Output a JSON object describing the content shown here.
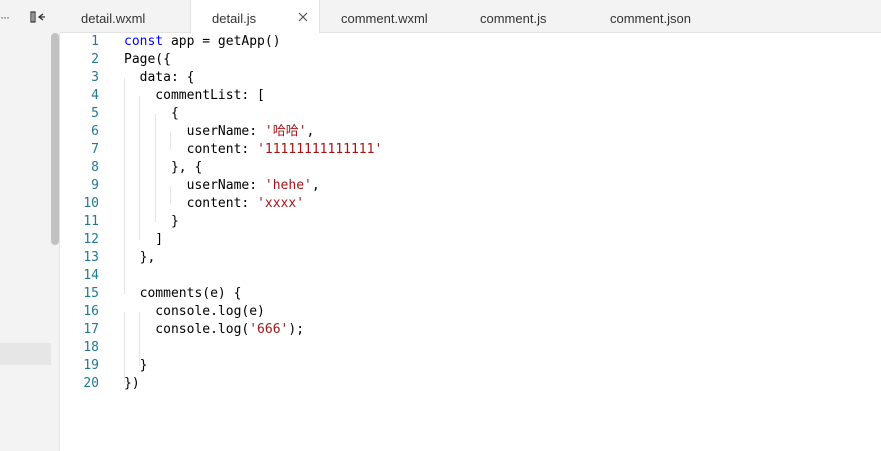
{
  "tabs": [
    {
      "label": "detail.wxml",
      "active": false
    },
    {
      "label": "detail.js",
      "active": true
    },
    {
      "label": "comment.wxml",
      "active": false
    },
    {
      "label": "comment.js",
      "active": false
    },
    {
      "label": "comment.json",
      "active": false
    }
  ],
  "left_panel": {
    "more_icon": "more-dots-icon",
    "collapse_icon": "collapse-sidebar-icon"
  },
  "editor": {
    "lines": [
      {
        "n": "1",
        "segments": [
          [
            "kw",
            "const"
          ],
          [
            "p",
            " app = getApp()"
          ]
        ]
      },
      {
        "n": "2",
        "segments": [
          [
            "p",
            "Page({"
          ]
        ]
      },
      {
        "n": "3",
        "segments": [
          [
            "p",
            "  data: {"
          ]
        ]
      },
      {
        "n": "4",
        "segments": [
          [
            "p",
            "    commentList: ["
          ]
        ]
      },
      {
        "n": "5",
        "segments": [
          [
            "p",
            "      {"
          ]
        ]
      },
      {
        "n": "6",
        "segments": [
          [
            "p",
            "        userName: "
          ],
          [
            "str",
            "'哈哈'"
          ],
          [
            "p",
            ","
          ]
        ]
      },
      {
        "n": "7",
        "segments": [
          [
            "p",
            "        content: "
          ],
          [
            "str",
            "'11111111111111'"
          ]
        ]
      },
      {
        "n": "8",
        "segments": [
          [
            "p",
            "      }, {"
          ]
        ]
      },
      {
        "n": "9",
        "segments": [
          [
            "p",
            "        userName: "
          ],
          [
            "str",
            "'hehe'"
          ],
          [
            "p",
            ","
          ]
        ]
      },
      {
        "n": "10",
        "segments": [
          [
            "p",
            "        content: "
          ],
          [
            "str",
            "'xxxx'"
          ]
        ]
      },
      {
        "n": "11",
        "segments": [
          [
            "p",
            "      }"
          ]
        ]
      },
      {
        "n": "12",
        "segments": [
          [
            "p",
            "    ]"
          ]
        ]
      },
      {
        "n": "13",
        "segments": [
          [
            "p",
            "  },"
          ]
        ]
      },
      {
        "n": "14",
        "segments": [
          [
            "p",
            ""
          ]
        ]
      },
      {
        "n": "15",
        "segments": [
          [
            "p",
            "  comments(e) {"
          ]
        ]
      },
      {
        "n": "16",
        "segments": [
          [
            "p",
            "    console.log(e)"
          ]
        ]
      },
      {
        "n": "17",
        "segments": [
          [
            "p",
            "    console.log("
          ],
          [
            "str",
            "'666'"
          ],
          [
            "p",
            ");"
          ]
        ]
      },
      {
        "n": "18",
        "segments": [
          [
            "p",
            ""
          ]
        ]
      },
      {
        "n": "19",
        "segments": [
          [
            "p",
            "  }"
          ]
        ]
      },
      {
        "n": "20",
        "segments": [
          [
            "p",
            "})"
          ]
        ]
      }
    ]
  },
  "colors": {
    "keyword": "#0000ff",
    "string": "#a31515",
    "line_number": "#237893"
  }
}
